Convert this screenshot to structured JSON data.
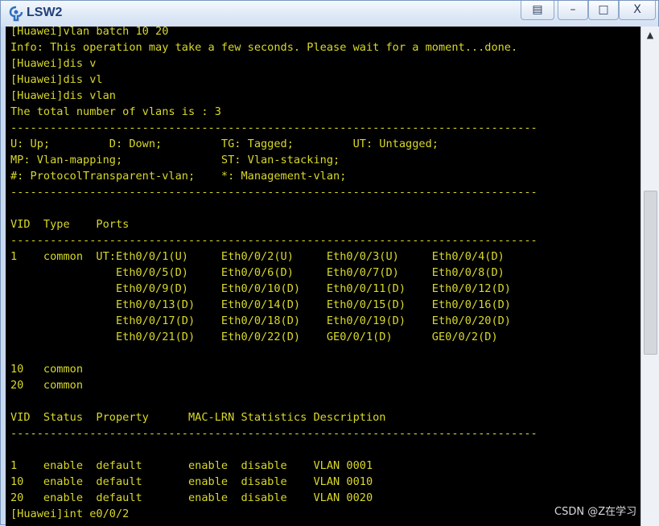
{
  "window": {
    "title": "LSW2",
    "controls": {
      "extra": "▤",
      "minimize": "–",
      "maximize": "□",
      "close": "X"
    }
  },
  "terminal": {
    "lines": [
      "[Huawei]vlan batch 10 20",
      "Info: This operation may take a few seconds. Please wait for a moment...done.",
      "[Huawei]dis v",
      "[Huawei]dis vl",
      "[Huawei]dis vlan",
      "The total number of vlans is : 3",
      "--------------------------------------------------------------------------------",
      "U: Up;         D: Down;         TG: Tagged;         UT: Untagged;",
      "MP: Vlan-mapping;               ST: Vlan-stacking;",
      "#: ProtocolTransparent-vlan;    *: Management-vlan;",
      "--------------------------------------------------------------------------------",
      "",
      "VID  Type    Ports",
      "--------------------------------------------------------------------------------",
      "1    common  UT:Eth0/0/1(U)     Eth0/0/2(U)     Eth0/0/3(U)     Eth0/0/4(D)",
      "                Eth0/0/5(D)     Eth0/0/6(D)     Eth0/0/7(D)     Eth0/0/8(D)",
      "                Eth0/0/9(D)     Eth0/0/10(D)    Eth0/0/11(D)    Eth0/0/12(D)",
      "                Eth0/0/13(D)    Eth0/0/14(D)    Eth0/0/15(D)    Eth0/0/16(D)",
      "                Eth0/0/17(D)    Eth0/0/18(D)    Eth0/0/19(D)    Eth0/0/20(D)",
      "                Eth0/0/21(D)    Eth0/0/22(D)    GE0/0/1(D)      GE0/0/2(D)",
      "",
      "10   common",
      "20   common",
      "",
      "VID  Status  Property      MAC-LRN Statistics Description",
      "--------------------------------------------------------------------------------",
      "",
      "1    enable  default       enable  disable    VLAN 0001",
      "10   enable  default       enable  disable    VLAN 0010",
      "20   enable  default       enable  disable    VLAN 0020",
      "[Huawei]int e0/0/2"
    ]
  },
  "scrollbar": {
    "up_arrow": "▲"
  },
  "watermark": "CSDN @Z在学习",
  "colors": {
    "terminal_bg": "#000000",
    "terminal_text": "#d8d82a",
    "title_text": "#1f3f7a"
  }
}
